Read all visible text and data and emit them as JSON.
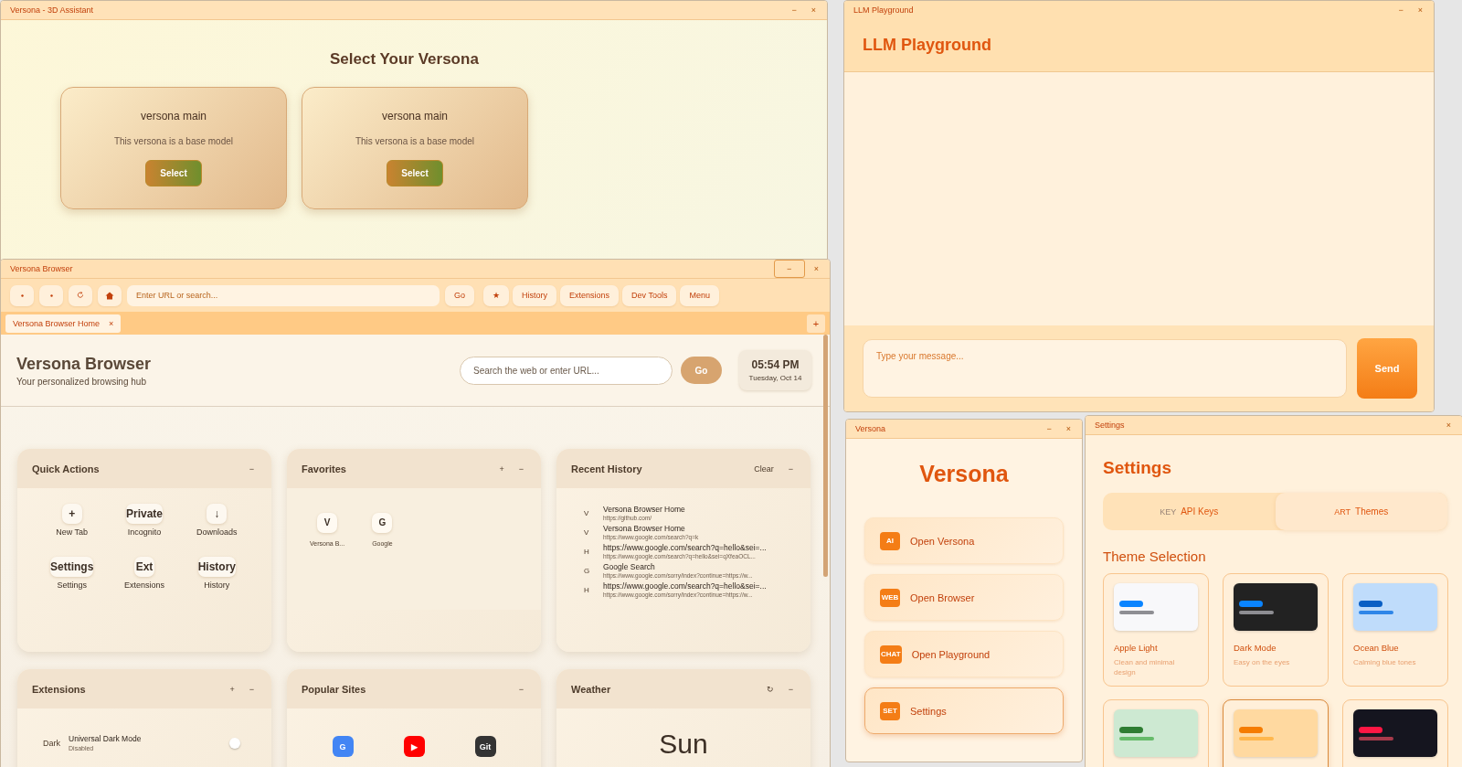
{
  "assistant_window": {
    "title": "Versona - 3D Assistant",
    "controls": [
      "−",
      "×"
    ],
    "heading": "Select Your Versona",
    "personas": [
      {
        "name": "versona main",
        "description": "This versona is a base model",
        "button": "Select"
      },
      {
        "name": "versona main",
        "description": "This versona is a base model",
        "button": "Select"
      }
    ]
  },
  "playground_window": {
    "title": "LLM Playground",
    "controls": [
      "−",
      "×"
    ],
    "heading": "LLM Playground",
    "message_input": {
      "placeholder": "Type your message..."
    },
    "send_button": "Send"
  },
  "browser_window": {
    "title": "Versona Browser",
    "controls": [
      {
        "symbol": "−",
        "focused": true
      },
      {
        "symbol": "×",
        "focused": false
      }
    ],
    "toolbar": {
      "nav_buttons": [
        {
          "kind": "back"
        },
        {
          "kind": "forward"
        },
        {
          "kind": "reload"
        },
        {
          "kind": "home"
        }
      ],
      "url_field": {
        "placeholder": "Enter URL or search..."
      },
      "go_button": "Go",
      "buttons": [
        "★",
        "History",
        "Extensions",
        "Dev Tools",
        "Menu"
      ]
    },
    "tabs": [
      {
        "label": "Versona Browser Home",
        "close": "×",
        "selected": true
      }
    ],
    "new_tab_button": "+",
    "header": {
      "title": "Versona Browser",
      "subtitle": "Your personalized browsing hub",
      "search": {
        "placeholder": "Search the web or enter URL..."
      },
      "go_button": "Go",
      "time": "05:54 PM",
      "date": "Tuesday, Oct 14"
    },
    "widgets": [
      {
        "kind": "quick_actions",
        "title": "Quick Actions",
        "actions": [
          "−"
        ],
        "items": [
          {
            "icon": "+",
            "label": "New Tab"
          },
          {
            "icon": "Private",
            "label": "Incognito"
          },
          {
            "icon": "↓",
            "label": "Downloads"
          },
          {
            "icon": "Settings",
            "label": "Settings"
          },
          {
            "icon": "Ext",
            "label": "Extensions"
          },
          {
            "icon": "History",
            "label": "History"
          }
        ]
      },
      {
        "kind": "favorites",
        "title": "Favorites",
        "actions": [
          "+",
          "−"
        ],
        "items": [
          {
            "icon": "V",
            "label": "Versona B..."
          },
          {
            "icon": "G",
            "label": "Google"
          }
        ]
      },
      {
        "kind": "history",
        "title": "Recent History",
        "actions": [
          "Clear",
          "−"
        ],
        "items": [
          {
            "icon": "V",
            "title": "Versona Browser Home",
            "url": "https://github.com/"
          },
          {
            "icon": "V",
            "title": "Versona Browser Home",
            "url": "https://www.google.com/search?q=k"
          },
          {
            "icon": "H",
            "title": "https://www.google.com/search?q=hello&sei=...",
            "url": "https://www.google.com/search?q=hello&sei=qXfeaOCL..."
          },
          {
            "icon": "G",
            "title": "Google Search",
            "url": "https://www.google.com/sorry/index?continue=https://w..."
          },
          {
            "icon": "H",
            "title": "https://www.google.com/search?q=hello&sei=...",
            "url": "https://www.google.com/sorry/index?continue=https://w..."
          }
        ]
      },
      {
        "kind": "extensions",
        "title": "Extensions",
        "actions": [
          "+",
          "−"
        ],
        "items": [
          {
            "icon": "Dark",
            "name": "Universal Dark Mode",
            "status": "Disabled",
            "on": false
          }
        ]
      },
      {
        "kind": "sites",
        "title": "Popular Sites",
        "actions": [
          "−"
        ],
        "items": [
          {
            "icon": "G",
            "color": "#4285f4"
          },
          {
            "icon": "▶",
            "color": "#ff0000"
          },
          {
            "icon": "Git",
            "color": "#333333"
          }
        ]
      },
      {
        "kind": "weather",
        "title": "Weather",
        "actions": [
          "↻",
          "−"
        ],
        "condition": "Sun"
      }
    ]
  },
  "launcher_window": {
    "title": "Versona",
    "controls": [
      "−",
      "×"
    ],
    "heading": "Versona",
    "items": [
      {
        "badge": "AI",
        "label": "Open Versona",
        "selected": false
      },
      {
        "badge": "WEB",
        "label": "Open Browser",
        "selected": false
      },
      {
        "badge": "CHAT",
        "label": "Open Playground",
        "selected": false
      },
      {
        "badge": "SET",
        "label": "Settings",
        "selected": true
      }
    ]
  },
  "settings_window": {
    "title": "Settings",
    "controls": [
      "×"
    ],
    "heading": "Settings",
    "tabs": [
      {
        "icon": "KEY",
        "label": "API Keys",
        "selected": false
      },
      {
        "icon": "ART",
        "label": "Themes",
        "selected": true
      }
    ],
    "section": "Theme Selection",
    "themes": [
      {
        "name": "Apple Light",
        "description": "Clean and minimal design",
        "color": "#f8f8fa",
        "bars": [
          {
            "color": "#0a84ff"
          },
          {
            "color": "#8e8e93"
          }
        ],
        "selected": false
      },
      {
        "name": "Dark Mode",
        "description": "Easy on the eyes",
        "color": "#222222",
        "bars": [
          {
            "color": "#0a84ff"
          },
          {
            "color": "#8e8e93"
          }
        ],
        "selected": false
      },
      {
        "name": "Ocean Blue",
        "description": "Calming blue tones",
        "color": "#bfdcfb",
        "bars": [
          {
            "color": "#0a5fc4"
          },
          {
            "color": "#2f86e8"
          }
        ],
        "selected": false
      },
      {
        "color": "#cde9d2",
        "bars": [
          {
            "color": "#2e7d32"
          },
          {
            "color": "#66bb6a"
          }
        ],
        "selected": false
      },
      {
        "color": "#ffd9a0",
        "bars": [
          {
            "color": "#f57c00"
          },
          {
            "color": "#ffb74d"
          }
        ],
        "selected": true
      },
      {
        "color": "#15151f",
        "bars": [
          {
            "color": "#ff1744"
          },
          {
            "color": "#a83a4b"
          }
        ],
        "selected": false
      }
    ]
  }
}
